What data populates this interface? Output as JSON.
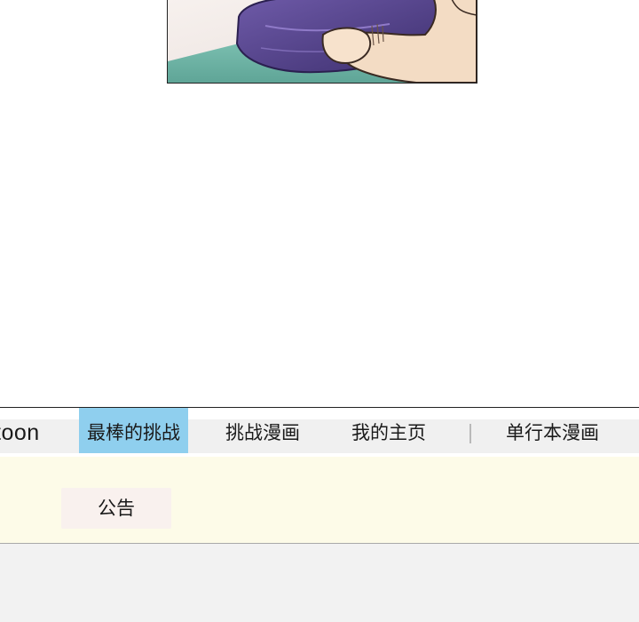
{
  "nav": {
    "brand": "toon",
    "items": [
      {
        "label": "最棒的挑战",
        "active": true
      },
      {
        "label": "挑战漫画",
        "active": false
      },
      {
        "label": "我的主页",
        "active": false
      },
      {
        "label": "单行本漫画",
        "active": false
      }
    ]
  },
  "notice": {
    "button_label": "公告"
  },
  "colors": {
    "active_tab": "#8fcfee",
    "notice_bg": "#fdfbe8",
    "footer_bg": "#f2f2f2"
  }
}
